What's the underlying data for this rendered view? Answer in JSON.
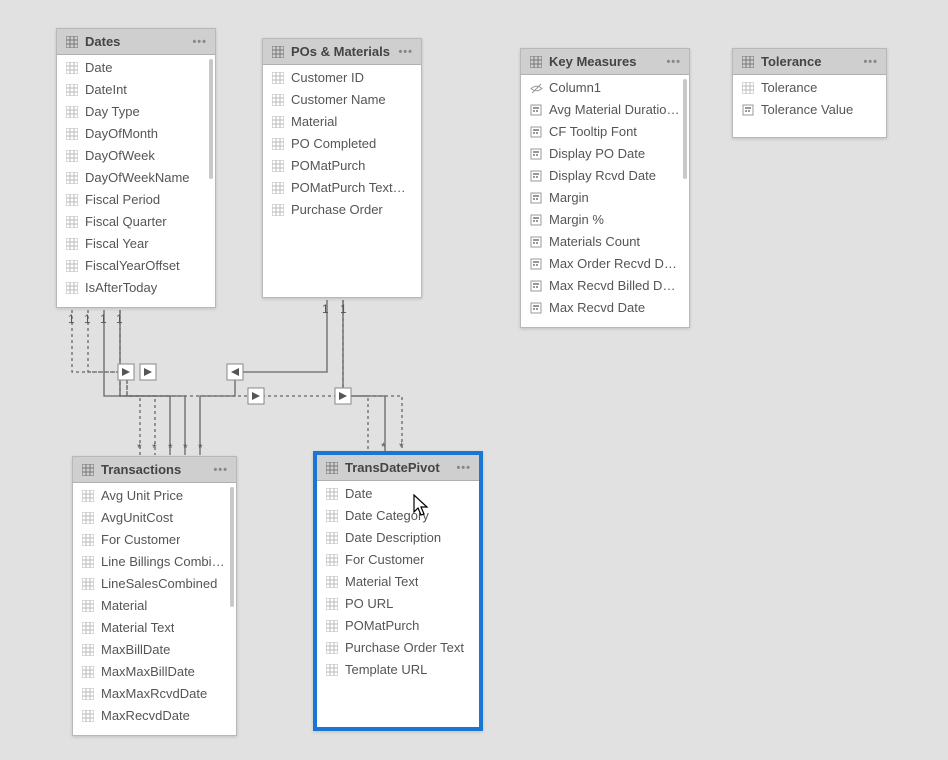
{
  "tables": {
    "dates": {
      "title": "Dates",
      "fields": [
        {
          "label": "Date",
          "icon": "column"
        },
        {
          "label": "DateInt",
          "icon": "column"
        },
        {
          "label": "Day Type",
          "icon": "column"
        },
        {
          "label": "DayOfMonth",
          "icon": "column"
        },
        {
          "label": "DayOfWeek",
          "icon": "column"
        },
        {
          "label": "DayOfWeekName",
          "icon": "column"
        },
        {
          "label": "Fiscal Period",
          "icon": "column"
        },
        {
          "label": "Fiscal Quarter",
          "icon": "column"
        },
        {
          "label": "Fiscal Year",
          "icon": "column"
        },
        {
          "label": "FiscalYearOffset",
          "icon": "column"
        },
        {
          "label": "IsAfterToday",
          "icon": "column"
        }
      ]
    },
    "pos_materials": {
      "title": "POs & Materials",
      "fields": [
        {
          "label": "Customer ID",
          "icon": "column"
        },
        {
          "label": "Customer Name",
          "icon": "column"
        },
        {
          "label": "Material",
          "icon": "column"
        },
        {
          "label": "PO Completed",
          "icon": "column"
        },
        {
          "label": "POMatPurch",
          "icon": "column"
        },
        {
          "label": "POMatPurch TextDisp",
          "icon": "column"
        },
        {
          "label": "Purchase Order",
          "icon": "column"
        }
      ]
    },
    "key_measures": {
      "title": "Key Measures",
      "fields": [
        {
          "label": "Column1",
          "icon": "hidden"
        },
        {
          "label": "Avg Material Duration...",
          "icon": "measure"
        },
        {
          "label": "CF Tooltip Font",
          "icon": "measure"
        },
        {
          "label": "Display PO Date",
          "icon": "measure"
        },
        {
          "label": "Display Rcvd Date",
          "icon": "measure"
        },
        {
          "label": "Margin",
          "icon": "measure"
        },
        {
          "label": "Margin %",
          "icon": "measure"
        },
        {
          "label": "Materials Count",
          "icon": "measure"
        },
        {
          "label": "Max Order Recvd Days",
          "icon": "measure"
        },
        {
          "label": "Max Recvd Billed Days",
          "icon": "measure"
        },
        {
          "label": "Max Recvd Date",
          "icon": "measure"
        }
      ]
    },
    "tolerance": {
      "title": "Tolerance",
      "fields": [
        {
          "label": "Tolerance",
          "icon": "column"
        },
        {
          "label": "Tolerance Value",
          "icon": "measure"
        }
      ]
    },
    "transactions": {
      "title": "Transactions",
      "fields": [
        {
          "label": "Avg Unit Price",
          "icon": "column"
        },
        {
          "label": "AvgUnitCost",
          "icon": "column"
        },
        {
          "label": "For Customer",
          "icon": "column"
        },
        {
          "label": "Line Billings Combined",
          "icon": "column"
        },
        {
          "label": "LineSalesCombined",
          "icon": "column"
        },
        {
          "label": "Material",
          "icon": "column"
        },
        {
          "label": "Material Text",
          "icon": "column"
        },
        {
          "label": "MaxBillDate",
          "icon": "column"
        },
        {
          "label": "MaxMaxBillDate",
          "icon": "column"
        },
        {
          "label": "MaxMaxRcvdDate",
          "icon": "column"
        },
        {
          "label": "MaxRecvdDate",
          "icon": "column"
        }
      ]
    },
    "transdatepivot": {
      "title": "TransDatePivot",
      "fields": [
        {
          "label": "Date",
          "icon": "column"
        },
        {
          "label": "Date Category",
          "icon": "column"
        },
        {
          "label": "Date Description",
          "icon": "column"
        },
        {
          "label": "For Customer",
          "icon": "column"
        },
        {
          "label": "Material Text",
          "icon": "column"
        },
        {
          "label": "PO URL",
          "icon": "column"
        },
        {
          "label": "POMatPurch",
          "icon": "column"
        },
        {
          "label": "Purchase Order Text",
          "icon": "column"
        },
        {
          "label": "Template URL",
          "icon": "column"
        }
      ]
    }
  },
  "cardinality": {
    "one": "1",
    "many": "*"
  }
}
